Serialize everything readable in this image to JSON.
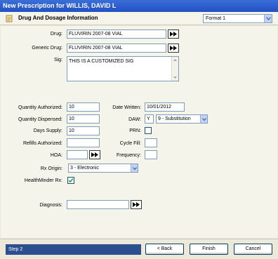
{
  "window": {
    "title": "New Prescription for WILLIS, DAVID L"
  },
  "section": {
    "title": "Drug And Dosage Information"
  },
  "format": {
    "selected": "Format 1"
  },
  "form": {
    "drug": {
      "label": "Drug:",
      "value": "FLUVIRIN 2007-08 VIAL"
    },
    "generic_drug": {
      "label": "Generic Drug:",
      "value": "FLUVIRIN 2007-08 VIAL"
    },
    "sig": {
      "label": "Sig:",
      "value": "THIS IS A CUSTOMIZED SIG"
    },
    "quantity_authorized": {
      "label": "Quantity Authorized:",
      "value": "10"
    },
    "date_written": {
      "label": "Date Written:",
      "value": "10/01/2012"
    },
    "quantity_dispensed": {
      "label": "Quantity Dispensed:",
      "value": "10"
    },
    "daw": {
      "label": "DAW:",
      "flag": "Y",
      "selected": "9 - Substitution"
    },
    "days_supply": {
      "label": "Days Supply:",
      "value": "10"
    },
    "prn": {
      "label": "PRN:",
      "checked": false
    },
    "refills_authorized": {
      "label": "Refills Authorized:",
      "value": ""
    },
    "cycle_fill": {
      "label": "Cycle Fill:",
      "value": ""
    },
    "hoa": {
      "label": "HOA:",
      "value": ""
    },
    "frequency": {
      "label": "Frequency:",
      "value": ""
    },
    "rx_origin": {
      "label": "Rx Origin:",
      "selected": "3 - Electronic"
    },
    "healthminder_rx": {
      "label": "HealthMinder Rx:",
      "checked": true
    },
    "diagnosis": {
      "label": "Diagnosis:",
      "value": ""
    }
  },
  "footer": {
    "step": "Step 2",
    "back_label": "< Back",
    "finish_label": "Finish",
    "cancel_label": "Cancel"
  },
  "icons": {
    "lookup": "double-arrow-right-icon",
    "dropdown": "chevron-down-icon",
    "check": "checkmark-icon",
    "header": "prescription-pad-icon"
  },
  "colors": {
    "titlebar": "#2250C4",
    "step_bar": "#2B4F8F",
    "panel": "#F5F4EA",
    "frame": "#ECE9D8"
  }
}
